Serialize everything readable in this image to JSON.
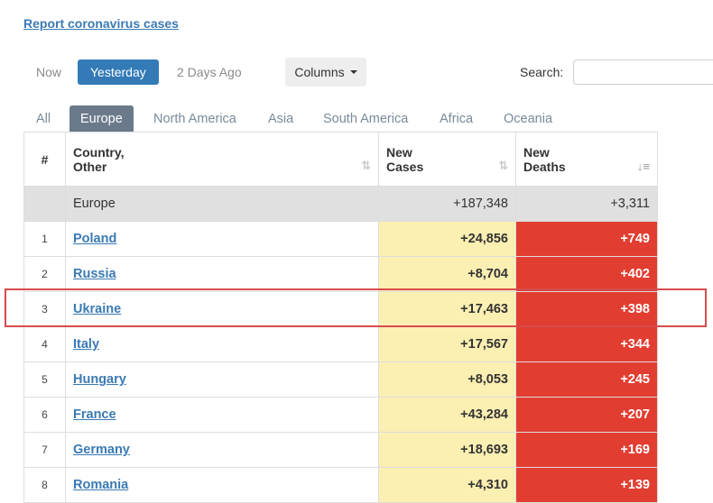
{
  "report_link": "Report coronavirus cases",
  "day_tabs": [
    "Now",
    "Yesterday",
    "2 Days Ago"
  ],
  "columns_button": "Columns",
  "search": {
    "label": "Search:",
    "value": "",
    "placeholder": ""
  },
  "region_tabs": [
    "All",
    "Europe",
    "North America",
    "Asia",
    "South America",
    "Africa",
    "Oceania"
  ],
  "table": {
    "headers": {
      "index": "#",
      "country_line1": "Country,",
      "country_line2": "Other",
      "cases_line1": "New",
      "cases_line2": "Cases",
      "deaths_line1": "New",
      "deaths_line2": "Deaths"
    },
    "total": {
      "name": "Europe",
      "new_cases": "+187,348",
      "new_deaths": "+3,311"
    },
    "rows": [
      {
        "idx": "1",
        "country": "Poland",
        "new_cases": "+24,856",
        "new_deaths": "+749"
      },
      {
        "idx": "2",
        "country": "Russia",
        "new_cases": "+8,704",
        "new_deaths": "+402"
      },
      {
        "idx": "3",
        "country": "Ukraine",
        "new_cases": "+17,463",
        "new_deaths": "+398"
      },
      {
        "idx": "4",
        "country": "Italy",
        "new_cases": "+17,567",
        "new_deaths": "+344"
      },
      {
        "idx": "5",
        "country": "Hungary",
        "new_cases": "+8,053",
        "new_deaths": "+245"
      },
      {
        "idx": "6",
        "country": "France",
        "new_cases": "+43,284",
        "new_deaths": "+207"
      },
      {
        "idx": "7",
        "country": "Germany",
        "new_cases": "+18,693",
        "new_deaths": "+169"
      },
      {
        "idx": "8",
        "country": "Romania",
        "new_cases": "+4,310",
        "new_deaths": "+139"
      }
    ]
  },
  "colors": {
    "link": "#3a7ab3",
    "active_day_tab": "#337ab7",
    "active_region_tab": "#6b7a8b",
    "cases_cell": "#fcefb2",
    "deaths_cell": "#e23d31",
    "highlight_border": "#d64c4c"
  },
  "icons": {
    "sort_unsorted": "sort-arrows-icon",
    "sort_desc": "sort-desc-icon",
    "dropdown": "caret-down-icon"
  }
}
